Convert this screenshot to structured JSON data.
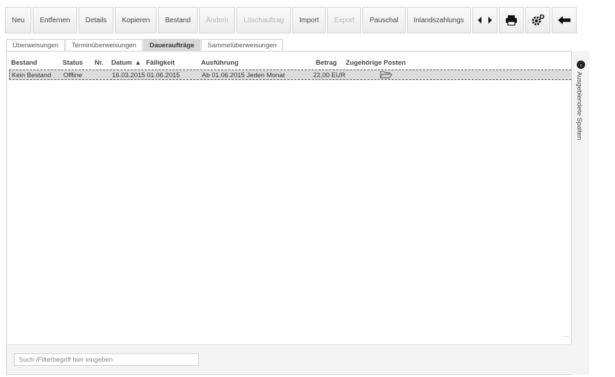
{
  "toolbar": {
    "buttons": [
      {
        "label": "Neu",
        "enabled": true
      },
      {
        "label": "Entfernen",
        "enabled": true
      },
      {
        "label": "Details",
        "enabled": true
      },
      {
        "label": "Kopieren",
        "enabled": true
      },
      {
        "label": "Bestand",
        "enabled": true
      },
      {
        "label": "Ändern",
        "enabled": false
      },
      {
        "label": "Löschauftrag",
        "enabled": false
      },
      {
        "label": "Import",
        "enabled": true
      },
      {
        "label": "Export",
        "enabled": false
      },
      {
        "label": "Pauschal",
        "enabled": true
      },
      {
        "label": "Inlandszahlungs",
        "enabled": true
      }
    ],
    "icons": [
      "scroll-left-right-icon",
      "printer-icon",
      "gear-icon",
      "back-arrow-icon"
    ]
  },
  "tabs": [
    {
      "label": "Überweisungen",
      "active": false
    },
    {
      "label": "Terminüberweisungen",
      "active": false
    },
    {
      "label": "Daueraufträge",
      "active": true
    },
    {
      "label": "Sammelüberweisungen",
      "active": false
    }
  ],
  "table": {
    "columns": {
      "bestand": "Bestand",
      "status": "Status",
      "nr": "Nr.",
      "datum": "Datum",
      "faelligkeit": "Fälligkeit",
      "ausfuehrung": "Ausführung",
      "betrag": "Betrag",
      "posten": "Zugehörige Posten"
    },
    "sort_indicator": "▲",
    "rows": [
      {
        "bestand": "Kein Bestand",
        "status": "Offline",
        "nr": "",
        "datum": "16.03.2015",
        "faelligkeit": "01.06.2015",
        "ausfuehrung": "Ab 01.06.2015 Jeden Monat",
        "betrag": "22,00 EUR",
        "posten_icon": "folder-icon"
      }
    ]
  },
  "side_panel": {
    "label": "Ausgeblendete Spalten",
    "toggle_glyph": "‹"
  },
  "search": {
    "placeholder": "Such-/Filterbegriff hier eingeben",
    "value": ""
  }
}
